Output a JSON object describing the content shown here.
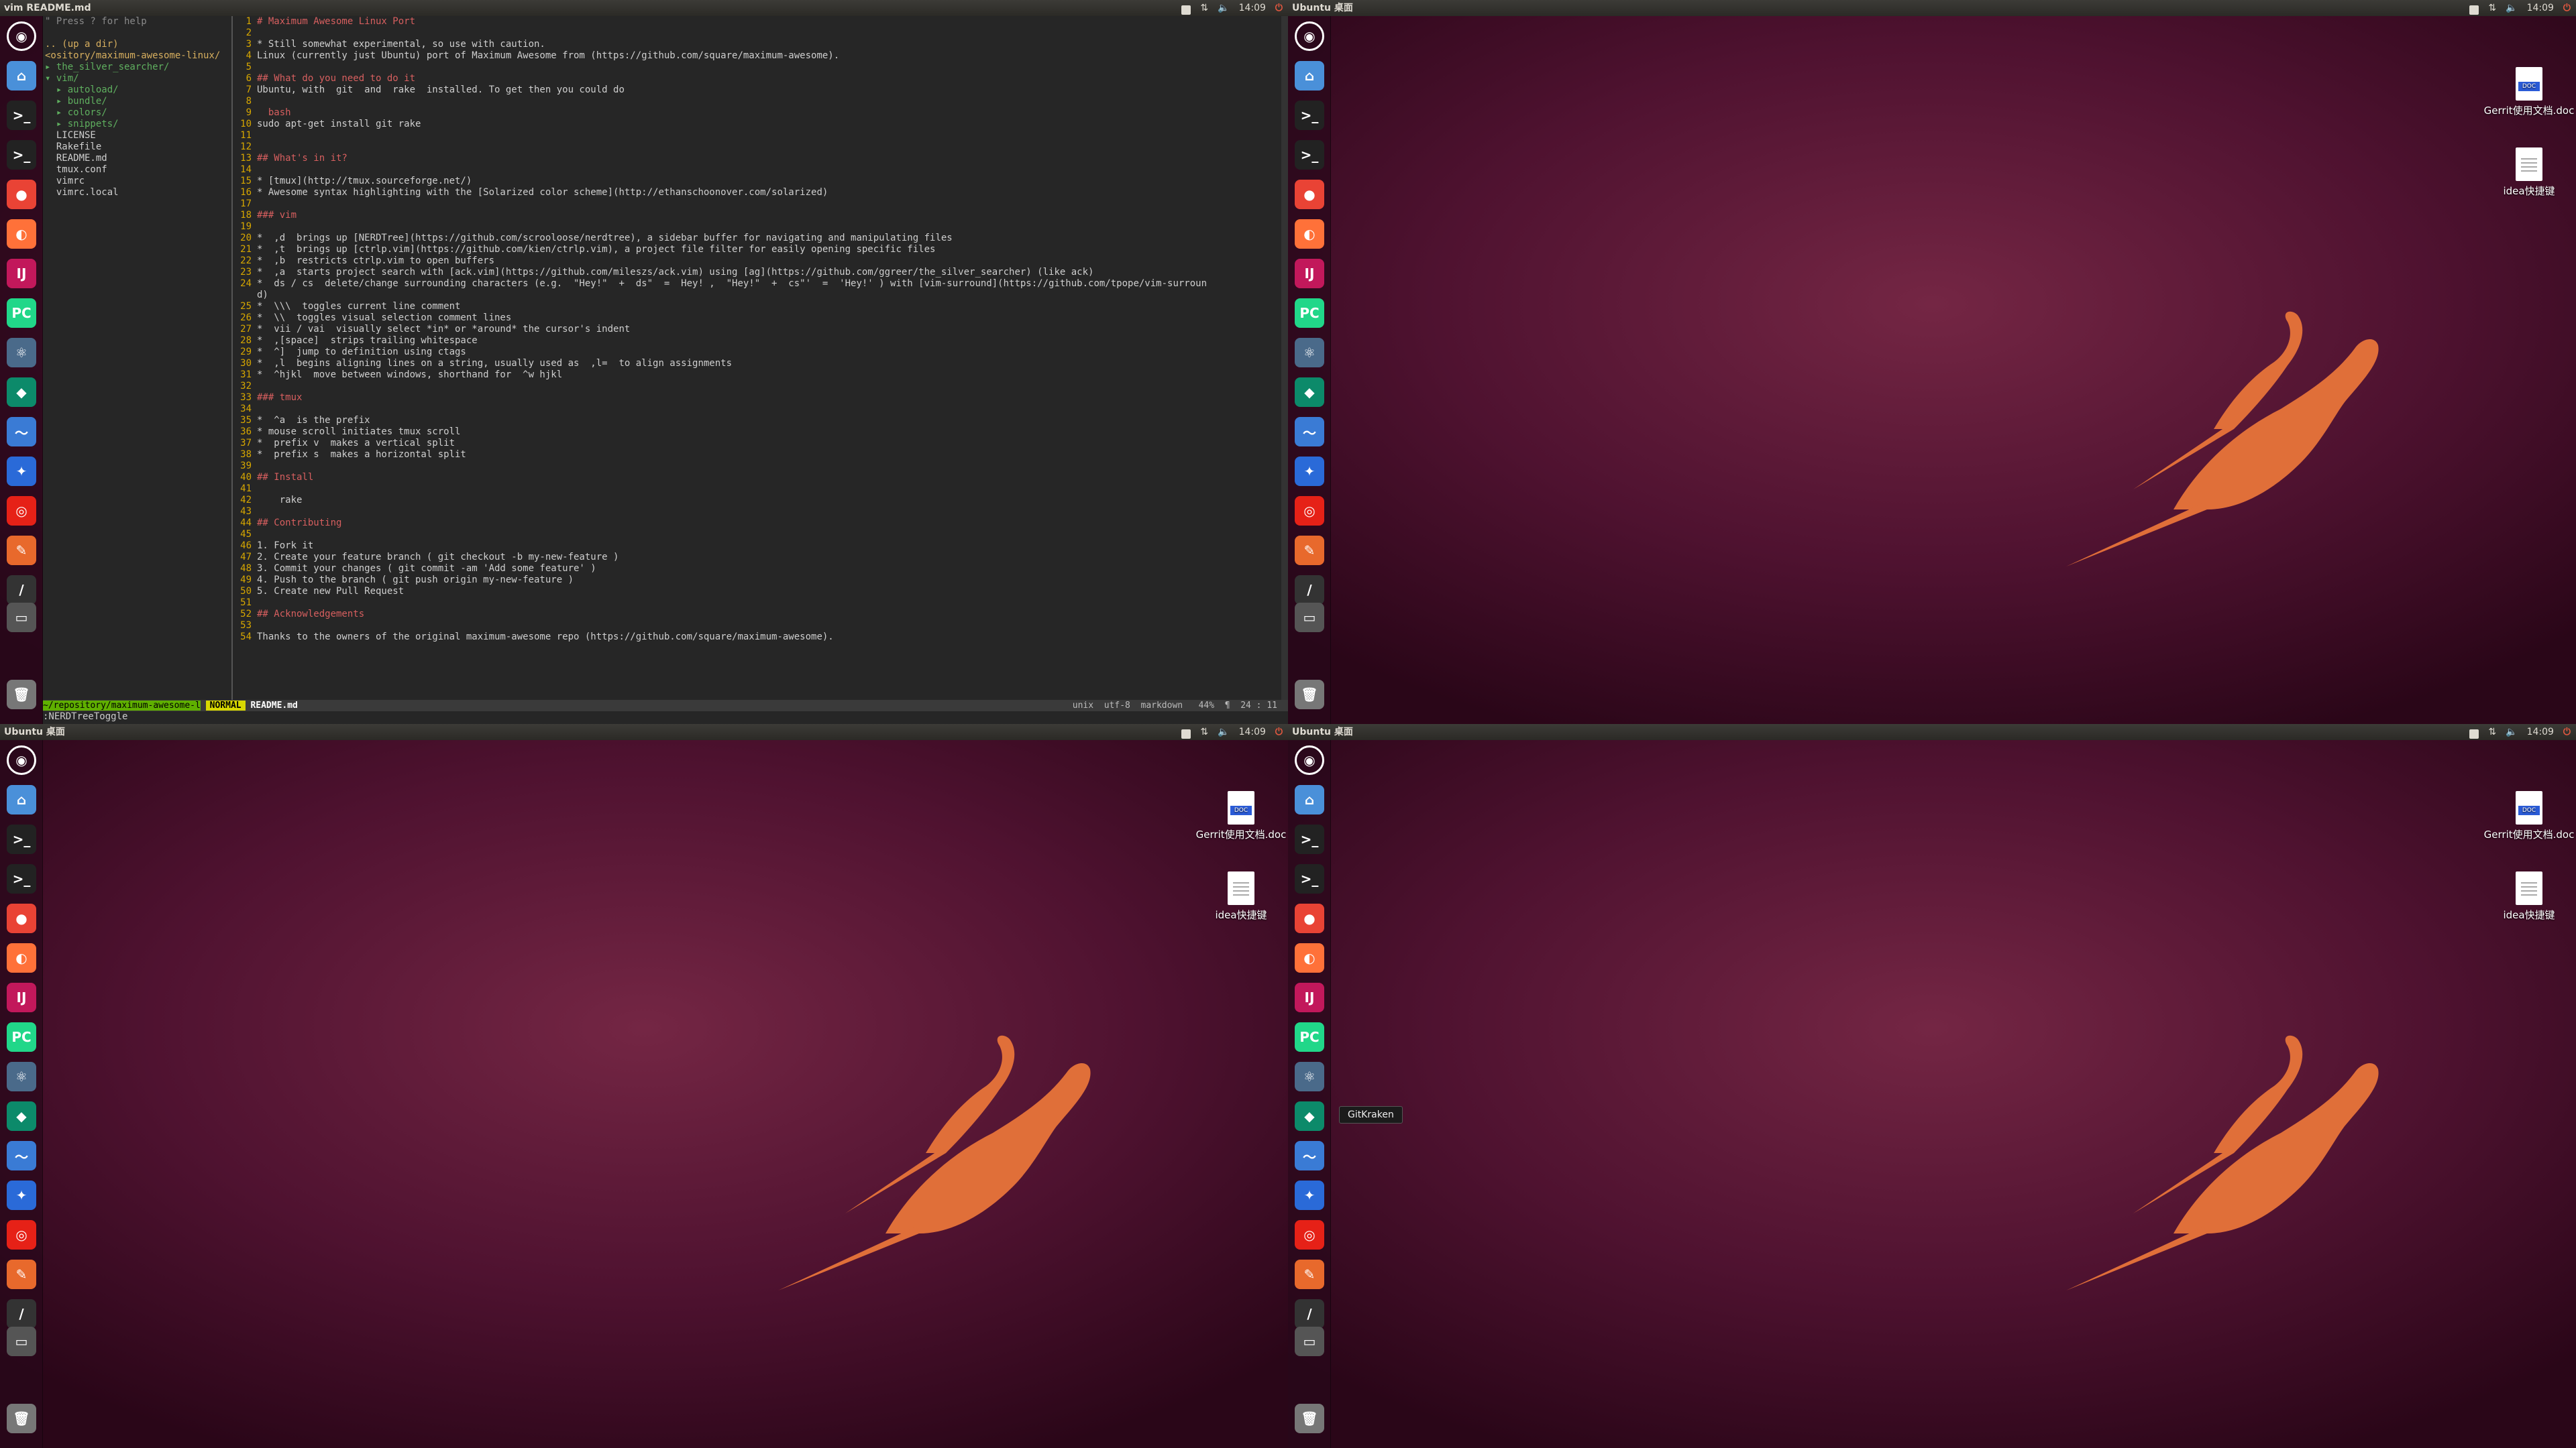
{
  "screens": [
    {
      "top_title": "vim README.md",
      "time": "14:09"
    },
    {
      "top_title": "Ubuntu 桌面",
      "time": "14:09"
    },
    {
      "top_title": "Ubuntu 桌面",
      "time": "14:09"
    },
    {
      "top_title": "Ubuntu 桌面",
      "time": "14:09"
    }
  ],
  "launcher_icons": [
    "ubuntu-dash-icon",
    "files-icon",
    "terminal-icon",
    "terminal-icon",
    "chrome-icon",
    "firefox-icon",
    "intellij-icon",
    "pycharm-icon",
    "atom-icon",
    "gitkraken-icon",
    "monitor-icon",
    "kingsoft-icon",
    "netease-music-icon",
    "jetbrains-toolbox-icon",
    "pen-icon",
    "drive-icon",
    "trash-icon"
  ],
  "launcher_glyphs": [
    "◉",
    "⌂",
    ">_",
    ">_",
    "●",
    "◐",
    "IJ",
    "PC",
    "⚛",
    "◆",
    "〜",
    "✦",
    "◎",
    "✎",
    "/",
    "▭",
    "🗑"
  ],
  "launcher_colors": [
    "#444",
    "#4a90d9",
    "#222",
    "#222",
    "#e94335",
    "#ff7139",
    "#c2185b",
    "#21d789",
    "#4a6a8a",
    "#0c8a6a",
    "#3a7bd5",
    "#2a6ad8",
    "#e62117",
    "#e8692c",
    "#333",
    "#555",
    "#777"
  ],
  "desktop_icons": [
    {
      "label": "Gerrit使用文档.doc",
      "kind": "doc"
    },
    {
      "label": "idea快捷键",
      "kind": "plain"
    }
  ],
  "tooltip": "GitKraken",
  "vim": {
    "tree": [
      {
        "t": "\" Press ? for help",
        "c": "dim"
      },
      {
        "t": "",
        "c": ""
      },
      {
        "t": ".. (up a dir)",
        "c": "yl"
      },
      {
        "t": "<ository/maximum-awesome-linux/",
        "c": "yl"
      },
      {
        "t": "▸ the_silver_searcher/",
        "c": "gr"
      },
      {
        "t": "▾ vim/",
        "c": "gr"
      },
      {
        "t": "  ▸ autoload/",
        "c": "gr"
      },
      {
        "t": "  ▸ bundle/",
        "c": "gr"
      },
      {
        "t": "  ▸ colors/",
        "c": "gr"
      },
      {
        "t": "  ▸ snippets/",
        "c": "gr"
      },
      {
        "t": "  LICENSE",
        "c": ""
      },
      {
        "t": "  Rakefile",
        "c": ""
      },
      {
        "t": "  README.md",
        "c": ""
      },
      {
        "t": "  tmux.conf",
        "c": ""
      },
      {
        "t": "  vimrc",
        "c": ""
      },
      {
        "t": "  vimrc.local",
        "c": ""
      }
    ],
    "lines": [
      {
        "n": "1",
        "t": "# Maximum Awesome Linux Port",
        "c": "h"
      },
      {
        "n": "2",
        "t": "",
        "c": ""
      },
      {
        "n": "3",
        "t": "* Still somewhat experimental, so use with caution.",
        "c": ""
      },
      {
        "n": "4",
        "t": "Linux (currently just Ubuntu) port of Maximum Awesome from (https://github.com/square/maximum-awesome).",
        "c": ""
      },
      {
        "n": "5",
        "t": "",
        "c": ""
      },
      {
        "n": "6",
        "t": "## What do you need to do it",
        "c": "h"
      },
      {
        "n": "7",
        "t": "Ubuntu, with  git  and  rake  installed. To get then you could do",
        "c": ""
      },
      {
        "n": "8",
        "t": "",
        "c": ""
      },
      {
        "n": "9",
        "t": "  bash",
        "c": "h"
      },
      {
        "n": "10",
        "t": "sudo apt-get install git rake",
        "c": ""
      },
      {
        "n": "11",
        "t": "",
        "c": ""
      },
      {
        "n": "12",
        "t": "",
        "c": ""
      },
      {
        "n": "13",
        "t": "## What's in it?",
        "c": "h"
      },
      {
        "n": "14",
        "t": "",
        "c": ""
      },
      {
        "n": "15",
        "t": "* [tmux](http://tmux.sourceforge.net/)",
        "c": ""
      },
      {
        "n": "16",
        "t": "* Awesome syntax highlighting with the [Solarized color scheme](http://ethanschoonover.com/solarized)",
        "c": ""
      },
      {
        "n": "17",
        "t": "",
        "c": ""
      },
      {
        "n": "18",
        "t": "### vim",
        "c": "h"
      },
      {
        "n": "19",
        "t": "",
        "c": ""
      },
      {
        "n": "20",
        "t": "*  ,d  brings up [NERDTree](https://github.com/scrooloose/nerdtree), a sidebar buffer for navigating and manipulating files",
        "c": ""
      },
      {
        "n": "21",
        "t": "*  ,t  brings up [ctrlp.vim](https://github.com/kien/ctrlp.vim), a project file filter for easily opening specific files",
        "c": ""
      },
      {
        "n": "22",
        "t": "*  ,b  restricts ctrlp.vim to open buffers",
        "c": ""
      },
      {
        "n": "23",
        "t": "*  ,a  starts project search with [ack.vim](https://github.com/mileszs/ack.vim) using [ag](https://github.com/ggreer/the_silver_searcher) (like ack)",
        "c": ""
      },
      {
        "n": "24",
        "t": "*  ds / cs  delete/change surrounding characters (e.g.  \"Hey!\"  +  ds\"  =  Hey! ,  \"Hey!\"  +  cs\"'  =  'Hey!' ) with [vim-surround](https://github.com/tpope/vim-surroun",
        "c": ""
      },
      {
        "n": "",
        "t": "d)",
        "c": ""
      },
      {
        "n": "25",
        "t": "*  \\\\\\  toggles current line comment",
        "c": ""
      },
      {
        "n": "26",
        "t": "*  \\\\  toggles visual selection comment lines",
        "c": ""
      },
      {
        "n": "27",
        "t": "*  vii / vai  visually select *in* or *around* the cursor's indent",
        "c": ""
      },
      {
        "n": "28",
        "t": "*  ,[space]  strips trailing whitespace",
        "c": ""
      },
      {
        "n": "29",
        "t": "*  ^]  jump to definition using ctags",
        "c": ""
      },
      {
        "n": "30",
        "t": "*  ,l  begins aligning lines on a string, usually used as  ,l=  to align assignments",
        "c": ""
      },
      {
        "n": "31",
        "t": "*  ^hjkl  move between windows, shorthand for  ^w hjkl",
        "c": ""
      },
      {
        "n": "32",
        "t": "",
        "c": ""
      },
      {
        "n": "33",
        "t": "### tmux",
        "c": "h"
      },
      {
        "n": "34",
        "t": "",
        "c": ""
      },
      {
        "n": "35",
        "t": "*  ^a  is the prefix",
        "c": ""
      },
      {
        "n": "36",
        "t": "* mouse scroll initiates tmux scroll",
        "c": ""
      },
      {
        "n": "37",
        "t": "*  prefix v  makes a vertical split",
        "c": ""
      },
      {
        "n": "38",
        "t": "*  prefix s  makes a horizontal split",
        "c": ""
      },
      {
        "n": "39",
        "t": "",
        "c": ""
      },
      {
        "n": "40",
        "t": "## Install",
        "c": "h"
      },
      {
        "n": "41",
        "t": "",
        "c": ""
      },
      {
        "n": "42",
        "t": "    rake",
        "c": ""
      },
      {
        "n": "43",
        "t": "",
        "c": ""
      },
      {
        "n": "44",
        "t": "## Contributing",
        "c": "h"
      },
      {
        "n": "45",
        "t": "",
        "c": ""
      },
      {
        "n": "46",
        "t": "1. Fork it",
        "c": ""
      },
      {
        "n": "47",
        "t": "2. Create your feature branch ( git checkout -b my-new-feature )",
        "c": ""
      },
      {
        "n": "48",
        "t": "3. Commit your changes ( git commit -am 'Add some feature' )",
        "c": ""
      },
      {
        "n": "49",
        "t": "4. Push to the branch ( git push origin my-new-feature )",
        "c": ""
      },
      {
        "n": "50",
        "t": "5. Create new Pull Request",
        "c": ""
      },
      {
        "n": "51",
        "t": "",
        "c": ""
      },
      {
        "n": "52",
        "t": "## Acknowledgements",
        "c": "h"
      },
      {
        "n": "53",
        "t": "",
        "c": ""
      },
      {
        "n": "54",
        "t": "Thanks to the owners of the original maximum-awesome repo (https://github.com/square/maximum-awesome).",
        "c": ""
      }
    ],
    "status_left": "~/repository/maximum-awesome-l",
    "status_mode": "NORMAL",
    "status_file": "README.md",
    "status_right": "unix  utf-8  markdown   44%  ¶  24 : 11",
    "cmdline": ":NERDTreeToggle"
  }
}
